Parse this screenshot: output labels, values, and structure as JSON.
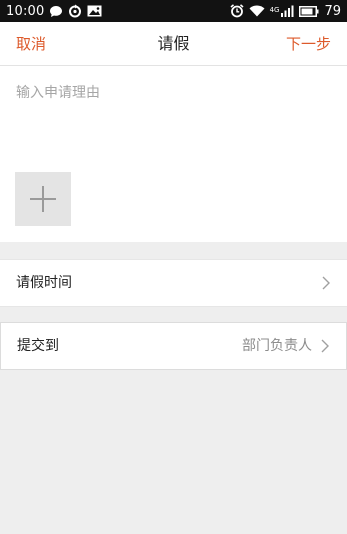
{
  "status_bar": {
    "time": "10:00",
    "signal_label": "4G",
    "battery_level": "79",
    "icons": [
      "chat-bubble-icon",
      "sync-icon",
      "image-icon",
      "alarm-icon",
      "wifi-icon",
      "signal-icon",
      "battery-icon"
    ]
  },
  "nav": {
    "cancel_label": "取消",
    "title": "请假",
    "next_label": "下一步"
  },
  "form": {
    "reason_placeholder": "输入申请理由",
    "reason_value": "",
    "add_photo_icon": "plus-icon"
  },
  "rows": {
    "time_label": "请假时间",
    "submit_label": "提交到",
    "submit_value": "部门负责人"
  },
  "colors": {
    "accent": "#dd5a2b",
    "status_bar": "#121212",
    "page_bg": "#eeeeee"
  }
}
